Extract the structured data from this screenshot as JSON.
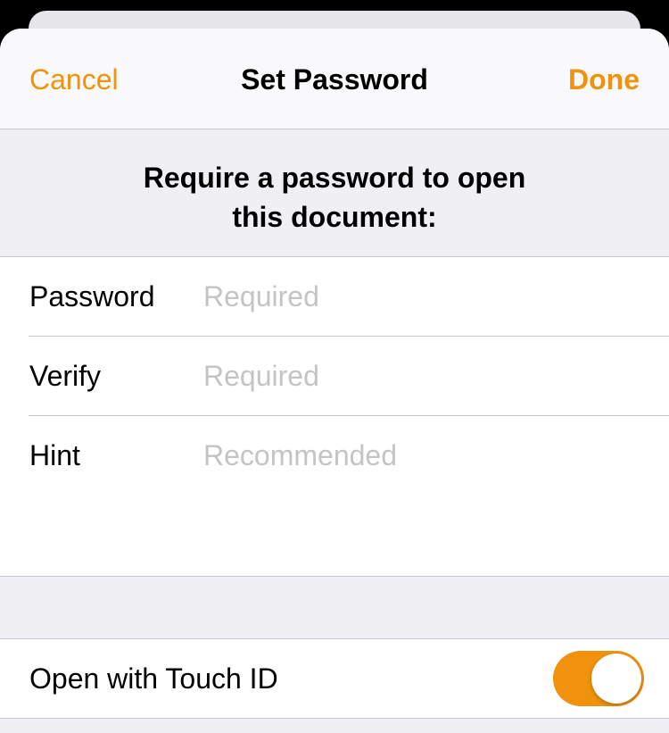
{
  "navbar": {
    "cancel_label": "Cancel",
    "title": "Set Password",
    "done_label": "Done"
  },
  "header": {
    "line1": "Require a password to open",
    "line2": "this document:"
  },
  "form": {
    "fields": [
      {
        "label": "Password",
        "placeholder": "Required",
        "value": ""
      },
      {
        "label": "Verify",
        "placeholder": "Required",
        "value": ""
      },
      {
        "label": "Hint",
        "placeholder": "Recommended",
        "value": ""
      }
    ]
  },
  "touch_id": {
    "label": "Open with Touch ID",
    "enabled": true
  },
  "colors": {
    "accent": "#f0920c",
    "background": "#efeff4",
    "separator": "#c8c7cc",
    "placeholder": "#c4c4c7"
  }
}
